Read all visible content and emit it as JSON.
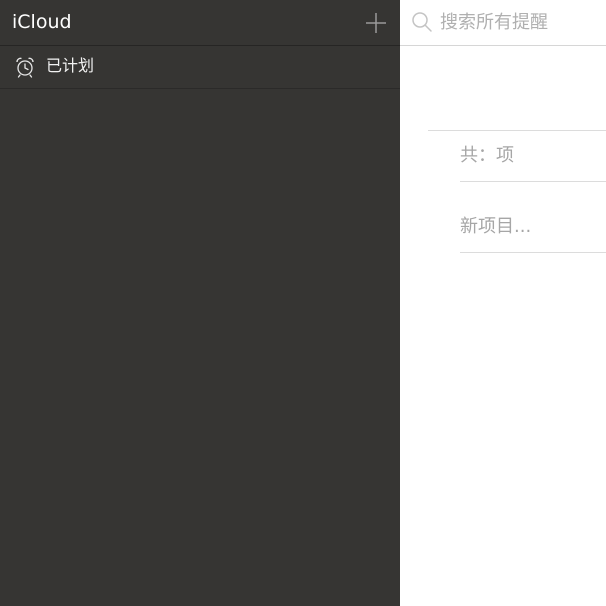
{
  "sidebar": {
    "account_title": "iCloud",
    "add_icon": "plus-icon",
    "items": [
      {
        "label": "已计划",
        "icon": "alarm-clock-icon"
      }
    ]
  },
  "main": {
    "search": {
      "placeholder": "搜索所有提醒",
      "icon": "search-icon"
    },
    "count_text": "共：项",
    "new_item_placeholder": "新项目..."
  },
  "colors": {
    "sidebar_background": "#363533",
    "main_background": "#ffffff",
    "muted_text": "#a6a6a6"
  }
}
